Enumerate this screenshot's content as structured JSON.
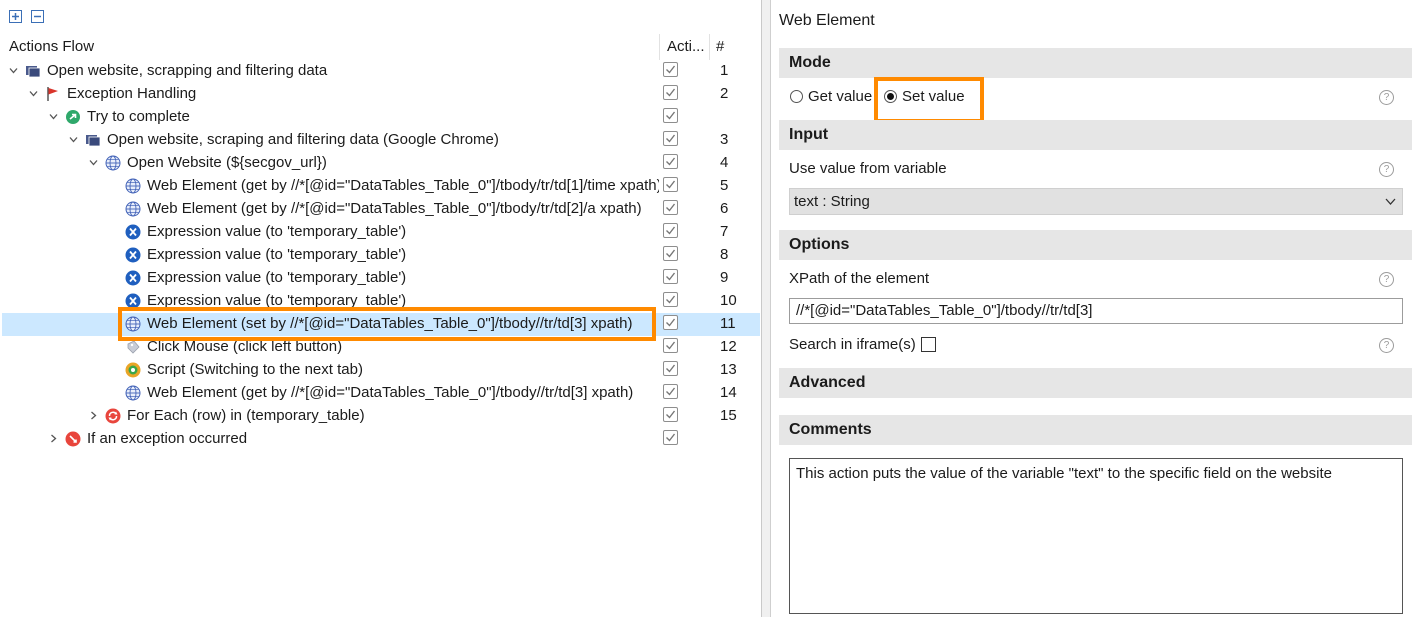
{
  "left": {
    "columns": {
      "name": "Actions Flow",
      "active": "Acti...",
      "num": "#"
    },
    "rows": [
      {
        "label": "Open website, scrapping and filtering data",
        "num": "1",
        "icon": "window-icon"
      },
      {
        "label": "Exception Handling",
        "num": "2",
        "icon": "flag-icon"
      },
      {
        "label": "Try to complete",
        "num": "",
        "icon": "try-icon"
      },
      {
        "label": "Open website, scraping and filtering data (Google Chrome)",
        "num": "3",
        "icon": "window-icon"
      },
      {
        "label": "Open Website (${secgov_url})",
        "num": "4",
        "icon": "globe-icon"
      },
      {
        "label": "Web Element (get by //*[@id=\"DataTables_Table_0\"]/tbody/tr/td[1]/time xpath)",
        "num": "5",
        "icon": "globe-icon"
      },
      {
        "label": "Web Element (get by //*[@id=\"DataTables_Table_0\"]/tbody/tr/td[2]/a xpath)",
        "num": "6",
        "icon": "globe-icon"
      },
      {
        "label": "Expression value (to 'temporary_table')",
        "num": "7",
        "icon": "expression-icon"
      },
      {
        "label": "Expression value (to 'temporary_table')",
        "num": "8",
        "icon": "expression-icon"
      },
      {
        "label": "Expression value (to 'temporary_table')",
        "num": "9",
        "icon": "expression-icon"
      },
      {
        "label": "Expression value (to 'temporary_table')",
        "num": "10",
        "icon": "expression-icon"
      },
      {
        "label": "Web Element (set by //*[@id=\"DataTables_Table_0\"]/tbody//tr/td[3] xpath)",
        "num": "11",
        "icon": "globe-icon"
      },
      {
        "label": "Click Mouse (click left button)",
        "num": "12",
        "icon": "mouse-icon"
      },
      {
        "label": "Script (Switching to the next tab)",
        "num": "13",
        "icon": "script-icon"
      },
      {
        "label": "Web Element (get by //*[@id=\"DataTables_Table_0\"]/tbody//tr/td[3] xpath)",
        "num": "14",
        "icon": "globe-icon"
      },
      {
        "label": "For Each (row) in (temporary_table)",
        "num": "15",
        "icon": "loop-icon"
      },
      {
        "label": "If an exception occurred",
        "num": "",
        "icon": "exception-icon"
      }
    ]
  },
  "right": {
    "title": "Web Element",
    "mode": {
      "header": "Mode",
      "get_label": "Get value",
      "set_label": "Set value",
      "selected": "set"
    },
    "input": {
      "header": "Input",
      "label": "Use value from variable",
      "selected_value": "text : String"
    },
    "options": {
      "header": "Options",
      "xpath_label": "XPath of the element",
      "xpath_value": "//*[@id=\"DataTables_Table_0\"]/tbody//tr/td[3]",
      "iframe_label": "Search in iframe(s)"
    },
    "advanced": {
      "header": "Advanced"
    },
    "comments": {
      "header": "Comments",
      "text": "This action puts the value of the variable \"text\" to the specific field on the website"
    }
  },
  "colors": {
    "selection": "#cce8ff",
    "highlight": "#ff8a00",
    "section_bg": "#e6e6e6"
  }
}
